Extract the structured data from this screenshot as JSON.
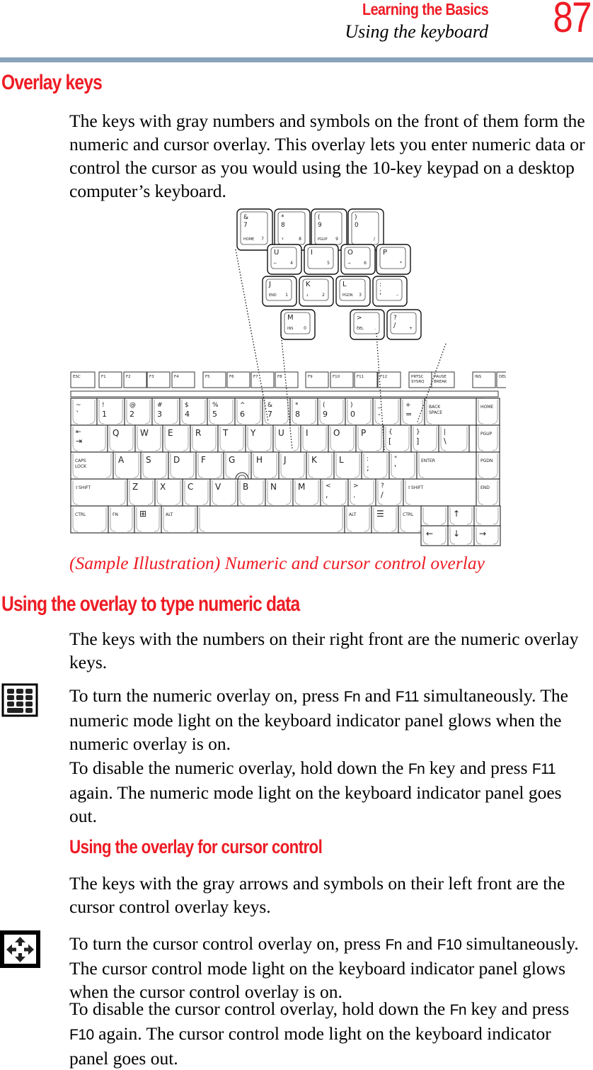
{
  "header": {
    "section": "Learning the Basics",
    "subsection": "Using the keyboard",
    "page_number": "87"
  },
  "overlay_keys": {
    "heading": "Overlay keys",
    "intro": "The keys with gray numbers and symbols on the front of them form the numeric and cursor overlay. This overlay lets you enter numeric data or control the cursor as you would using the 10-key keypad on a desktop computer’s keyboard.",
    "caption": "(Sample Illustration) Numeric and cursor control overlay"
  },
  "figure": {
    "overlay_keys": [
      {
        "top": "&",
        "main": "7",
        "left": "HOME",
        "right": "7"
      },
      {
        "top": "*",
        "main": "8",
        "left": "↑",
        "right": "8"
      },
      {
        "top": "(",
        "main": "9",
        "left": "PGUP",
        "right": "9"
      },
      {
        "top": ")",
        "main": "0",
        "left": "",
        "right": "/"
      },
      {
        "main": "U",
        "left": "←",
        "right": "4"
      },
      {
        "main": "I",
        "left": "",
        "right": "5"
      },
      {
        "main": "O",
        "left": "→",
        "right": "6"
      },
      {
        "main": "P",
        "left": "",
        "right": "*"
      },
      {
        "main": "J",
        "left": "END",
        "right": "1"
      },
      {
        "main": "K",
        "left": "↓",
        "right": "2"
      },
      {
        "main": "L",
        "left": "PGDN",
        "right": "3"
      },
      {
        "top": ":",
        "main": ";",
        "left": "",
        "right": "–"
      },
      {
        "main": "M",
        "left": "INS",
        "right": "0"
      },
      {
        "top": ">",
        "main": ".",
        "left": "DEL",
        "right": "."
      },
      {
        "top": "?",
        "main": "/",
        "left": "",
        "right": "+"
      }
    ],
    "function_row": [
      "ESC",
      "F1",
      "F2",
      "F3",
      "F4",
      "F5",
      "F6",
      "F7",
      "F8",
      "F9",
      "F10",
      "F11",
      "F12",
      "PRTSC SYSRQ",
      "PAUSE BREAK",
      "INS",
      "DEL"
    ],
    "number_row": [
      "~ `",
      "! 1",
      "@ 2",
      "# 3",
      "$ 4",
      "% 5",
      "^ 6",
      "& 7",
      "* 8",
      "( 9",
      ") 0",
      "_ -",
      "+ =",
      "BACK SPACE"
    ],
    "qwerty_row": [
      "TAB",
      "Q",
      "W",
      "E",
      "R",
      "T",
      "Y",
      "U",
      "I",
      "O",
      "P",
      "{ [",
      "} ]",
      "| \\"
    ],
    "home_row": [
      "CAPS LOCK",
      "A",
      "S",
      "D",
      "F",
      "G",
      "H",
      "J",
      "K",
      "L",
      ": ;",
      "\" '",
      "ENTER"
    ],
    "shift_row": [
      "SHIFT",
      "Z",
      "X",
      "C",
      "V",
      "B",
      "N",
      "M",
      "< ,",
      "> .",
      "? /",
      "SHIFT"
    ],
    "bottom_row": [
      "CTRL",
      "FN",
      "WIN",
      "ALT",
      "",
      "ALT",
      "APP",
      "CTRL"
    ],
    "nav_column": [
      "HOME",
      "PGUP",
      "PGDN",
      "END"
    ],
    "arrows": [
      "↑",
      "←",
      "↓",
      "→"
    ]
  },
  "numeric_section": {
    "heading": "Using the overlay to type numeric data",
    "intro": "The keys with the numbers on their right front are the numeric overlay keys.",
    "on_text": {
      "a": "To turn the numeric overlay on, press ",
      "k1": "Fn",
      "b": " and ",
      "k2": "F11",
      "c": " simultaneously. The numeric mode light on the keyboard indicator panel glows when the numeric overlay is on."
    },
    "off_text": {
      "a": "To disable the numeric overlay, hold down the ",
      "k1": "Fn",
      "b": " key and press ",
      "k2": "F11",
      "c": " again. The numeric mode light on the keyboard indicator panel goes out."
    },
    "icon": "numeric-keypad-icon"
  },
  "cursor_section": {
    "heading": "Using the overlay for cursor control",
    "intro": "The keys with the gray arrows and symbols on their left front are the cursor control overlay keys.",
    "on_text": {
      "a": "To turn the cursor control overlay on, press ",
      "k1": "Fn",
      "b": " and ",
      "k2": "F10",
      "c": " simultaneously. The cursor control mode light on the keyboard indicator panel glows when the cursor control overlay is on."
    },
    "off_text": {
      "a": "To disable the cursor control overlay, hold down the ",
      "k1": "Fn",
      "b": " key and press ",
      "k2": "F10",
      "c": " again. The cursor control mode light on the keyboard indicator panel goes out."
    },
    "icon": "cursor-arrows-icon"
  }
}
